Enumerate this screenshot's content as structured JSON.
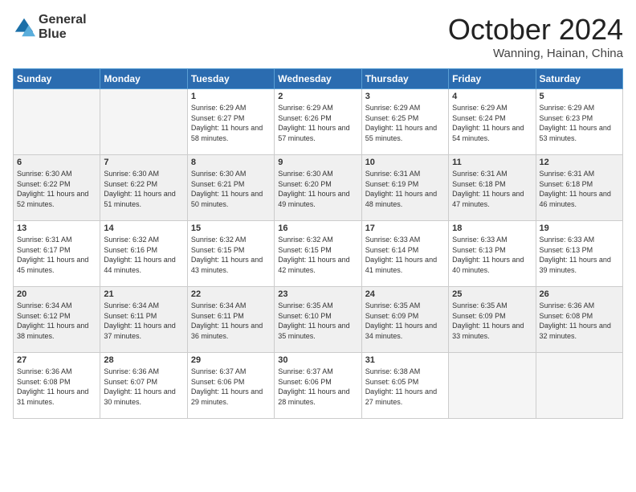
{
  "logo": {
    "line1": "General",
    "line2": "Blue"
  },
  "title": "October 2024",
  "subtitle": "Wanning, Hainan, China",
  "headers": [
    "Sunday",
    "Monday",
    "Tuesday",
    "Wednesday",
    "Thursday",
    "Friday",
    "Saturday"
  ],
  "weeks": [
    [
      {
        "day": "",
        "info": ""
      },
      {
        "day": "",
        "info": ""
      },
      {
        "day": "1",
        "info": "Sunrise: 6:29 AM\nSunset: 6:27 PM\nDaylight: 11 hours and 58 minutes."
      },
      {
        "day": "2",
        "info": "Sunrise: 6:29 AM\nSunset: 6:26 PM\nDaylight: 11 hours and 57 minutes."
      },
      {
        "day": "3",
        "info": "Sunrise: 6:29 AM\nSunset: 6:25 PM\nDaylight: 11 hours and 55 minutes."
      },
      {
        "day": "4",
        "info": "Sunrise: 6:29 AM\nSunset: 6:24 PM\nDaylight: 11 hours and 54 minutes."
      },
      {
        "day": "5",
        "info": "Sunrise: 6:29 AM\nSunset: 6:23 PM\nDaylight: 11 hours and 53 minutes."
      }
    ],
    [
      {
        "day": "6",
        "info": "Sunrise: 6:30 AM\nSunset: 6:22 PM\nDaylight: 11 hours and 52 minutes."
      },
      {
        "day": "7",
        "info": "Sunrise: 6:30 AM\nSunset: 6:22 PM\nDaylight: 11 hours and 51 minutes."
      },
      {
        "day": "8",
        "info": "Sunrise: 6:30 AM\nSunset: 6:21 PM\nDaylight: 11 hours and 50 minutes."
      },
      {
        "day": "9",
        "info": "Sunrise: 6:30 AM\nSunset: 6:20 PM\nDaylight: 11 hours and 49 minutes."
      },
      {
        "day": "10",
        "info": "Sunrise: 6:31 AM\nSunset: 6:19 PM\nDaylight: 11 hours and 48 minutes."
      },
      {
        "day": "11",
        "info": "Sunrise: 6:31 AM\nSunset: 6:18 PM\nDaylight: 11 hours and 47 minutes."
      },
      {
        "day": "12",
        "info": "Sunrise: 6:31 AM\nSunset: 6:18 PM\nDaylight: 11 hours and 46 minutes."
      }
    ],
    [
      {
        "day": "13",
        "info": "Sunrise: 6:31 AM\nSunset: 6:17 PM\nDaylight: 11 hours and 45 minutes."
      },
      {
        "day": "14",
        "info": "Sunrise: 6:32 AM\nSunset: 6:16 PM\nDaylight: 11 hours and 44 minutes."
      },
      {
        "day": "15",
        "info": "Sunrise: 6:32 AM\nSunset: 6:15 PM\nDaylight: 11 hours and 43 minutes."
      },
      {
        "day": "16",
        "info": "Sunrise: 6:32 AM\nSunset: 6:15 PM\nDaylight: 11 hours and 42 minutes."
      },
      {
        "day": "17",
        "info": "Sunrise: 6:33 AM\nSunset: 6:14 PM\nDaylight: 11 hours and 41 minutes."
      },
      {
        "day": "18",
        "info": "Sunrise: 6:33 AM\nSunset: 6:13 PM\nDaylight: 11 hours and 40 minutes."
      },
      {
        "day": "19",
        "info": "Sunrise: 6:33 AM\nSunset: 6:13 PM\nDaylight: 11 hours and 39 minutes."
      }
    ],
    [
      {
        "day": "20",
        "info": "Sunrise: 6:34 AM\nSunset: 6:12 PM\nDaylight: 11 hours and 38 minutes."
      },
      {
        "day": "21",
        "info": "Sunrise: 6:34 AM\nSunset: 6:11 PM\nDaylight: 11 hours and 37 minutes."
      },
      {
        "day": "22",
        "info": "Sunrise: 6:34 AM\nSunset: 6:11 PM\nDaylight: 11 hours and 36 minutes."
      },
      {
        "day": "23",
        "info": "Sunrise: 6:35 AM\nSunset: 6:10 PM\nDaylight: 11 hours and 35 minutes."
      },
      {
        "day": "24",
        "info": "Sunrise: 6:35 AM\nSunset: 6:09 PM\nDaylight: 11 hours and 34 minutes."
      },
      {
        "day": "25",
        "info": "Sunrise: 6:35 AM\nSunset: 6:09 PM\nDaylight: 11 hours and 33 minutes."
      },
      {
        "day": "26",
        "info": "Sunrise: 6:36 AM\nSunset: 6:08 PM\nDaylight: 11 hours and 32 minutes."
      }
    ],
    [
      {
        "day": "27",
        "info": "Sunrise: 6:36 AM\nSunset: 6:08 PM\nDaylight: 11 hours and 31 minutes."
      },
      {
        "day": "28",
        "info": "Sunrise: 6:36 AM\nSunset: 6:07 PM\nDaylight: 11 hours and 30 minutes."
      },
      {
        "day": "29",
        "info": "Sunrise: 6:37 AM\nSunset: 6:06 PM\nDaylight: 11 hours and 29 minutes."
      },
      {
        "day": "30",
        "info": "Sunrise: 6:37 AM\nSunset: 6:06 PM\nDaylight: 11 hours and 28 minutes."
      },
      {
        "day": "31",
        "info": "Sunrise: 6:38 AM\nSunset: 6:05 PM\nDaylight: 11 hours and 27 minutes."
      },
      {
        "day": "",
        "info": ""
      },
      {
        "day": "",
        "info": ""
      }
    ]
  ]
}
